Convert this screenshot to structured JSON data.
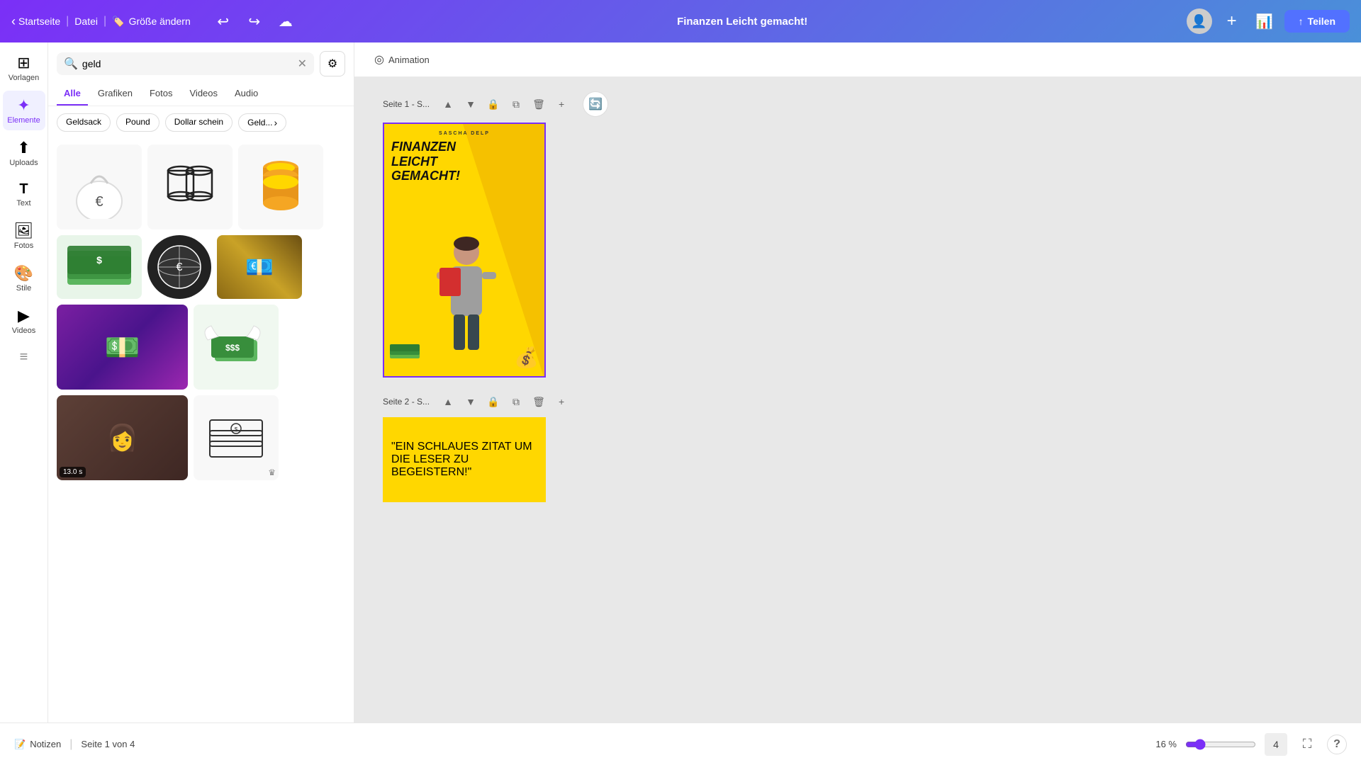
{
  "topbar": {
    "back_label": "Startseite",
    "file_label": "Datei",
    "size_label": "Größe ändern",
    "size_icon": "🏷️",
    "undo_icon": "↩",
    "redo_icon": "↪",
    "cloud_icon": "☁",
    "doc_title": "Finanzen Leicht gemacht!",
    "share_label": "Teilen",
    "share_icon": "↑"
  },
  "sidebar": {
    "items": [
      {
        "id": "vorlagen",
        "icon": "⊞",
        "label": "Vorlagen"
      },
      {
        "id": "elemente",
        "icon": "✦",
        "label": "Elemente",
        "active": true
      },
      {
        "id": "uploads",
        "icon": "⬆",
        "label": "Uploads"
      },
      {
        "id": "text",
        "icon": "T",
        "label": "Text"
      },
      {
        "id": "fotos",
        "icon": "🖼",
        "label": "Fotos"
      },
      {
        "id": "stile",
        "icon": "🎨",
        "label": "Stile"
      },
      {
        "id": "videos",
        "icon": "▶",
        "label": "Videos"
      },
      {
        "id": "patterns",
        "icon": "≡",
        "label": ""
      }
    ]
  },
  "search": {
    "query": "geld",
    "placeholder": "geld",
    "filter_icon": "⚙"
  },
  "categories": [
    {
      "id": "alle",
      "label": "Alle",
      "active": true
    },
    {
      "id": "grafiken",
      "label": "Grafiken"
    },
    {
      "id": "fotos",
      "label": "Fotos"
    },
    {
      "id": "videos",
      "label": "Videos"
    },
    {
      "id": "audio",
      "label": "Audio"
    }
  ],
  "tags": [
    {
      "id": "geldsack",
      "label": "Geldsack"
    },
    {
      "id": "pound",
      "label": "Pound"
    },
    {
      "id": "dollar-schein",
      "label": "Dollar schein"
    },
    {
      "id": "geld-more",
      "label": "Geld..."
    }
  ],
  "canvas": {
    "animation_label": "Animation",
    "pages": [
      {
        "id": "page1",
        "label": "Seite 1 - S...",
        "design": {
          "header_text": "SASCHA DELP",
          "title_line1": "FINANZEN",
          "title_line2": "LEICHT",
          "title_line3": "GEMACHT!"
        }
      },
      {
        "id": "page2",
        "label": "Seite 2 - S...",
        "design": {
          "quote_text": "\"EIN SCHLAUES ZITAT UM DIE LESER ZU BEGEISTERN!\""
        }
      }
    ]
  },
  "bottom_bar": {
    "notes_label": "Notizen",
    "notes_icon": "📝",
    "page_indicator": "Seite 1 von 4",
    "zoom_level": "16 %",
    "help_label": "?"
  },
  "graphics": [
    {
      "id": "euro-bag",
      "row": 1,
      "col": 1,
      "type": "svg",
      "desc": "Euro money bag white"
    },
    {
      "id": "coin-stack-bw",
      "row": 1,
      "col": 2,
      "type": "svg",
      "desc": "Coin stack black white"
    },
    {
      "id": "coin-stack-gold",
      "row": 1,
      "col": 3,
      "type": "svg",
      "desc": "Gold coin stack"
    },
    {
      "id": "green-cash",
      "row": 2,
      "col": 1,
      "type": "svg",
      "desc": "Green cash bills"
    },
    {
      "id": "euro-globe",
      "row": 2,
      "col": 2,
      "type": "svg",
      "desc": "Euro globe white"
    },
    {
      "id": "euro-photo",
      "row": 2,
      "col": 3,
      "type": "photo",
      "desc": "Euro banknotes photo"
    },
    {
      "id": "purple-notes",
      "row": 3,
      "col": 1,
      "type": "photo",
      "desc": "Purple 500 euro notes",
      "wide": true
    },
    {
      "id": "flying-money",
      "row": 3,
      "col": 2,
      "type": "svg",
      "desc": "Flying money with wings"
    },
    {
      "id": "woman-money",
      "row": 4,
      "col": 1,
      "type": "photo",
      "desc": "Woman counting money",
      "wide": true,
      "timer": "13.0 s"
    },
    {
      "id": "money-stack-bw",
      "row": 4,
      "col": 2,
      "type": "svg",
      "desc": "Money stack outline",
      "crown": true
    }
  ]
}
